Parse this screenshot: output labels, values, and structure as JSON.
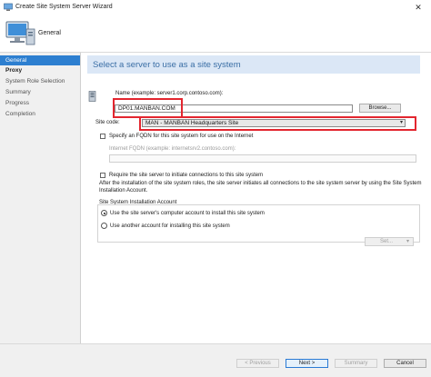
{
  "window": {
    "title": "Create Site System Server Wizard",
    "close_glyph": "✕"
  },
  "header": {
    "page_title": "General"
  },
  "nav": {
    "items": [
      {
        "label": "General"
      },
      {
        "label": "Proxy"
      },
      {
        "label": "System Role Selection"
      },
      {
        "label": "Summary"
      },
      {
        "label": "Progress"
      },
      {
        "label": "Completion"
      }
    ]
  },
  "main": {
    "heading": "Select a server to use as a site system",
    "name_label": "Name (example: server1.corp.contoso.com):",
    "name_value": "DP01.MANBAN.COM",
    "browse_label": "Browse...",
    "site_code_label": "Site code:",
    "site_code_value": "MAN - MANBAN Headquarters Site",
    "fqdn_checkbox_label": "Specify an FQDN for this site system for use on the Internet",
    "internet_fqdn_label": "Internet FQDN (example: internetsrv2.contoso.com):",
    "require_checkbox_label": "Require the site server to initiate connections to this site system",
    "info_text_line1": "After the installation of the site system roles, the site server initiates all connections to the site system server by using the Site System",
    "info_text_line2": "Installation Account.",
    "account_group_label": "Site System Installation Account",
    "radio_computer_label": "Use the site server's computer account to install this site system",
    "radio_another_label": "Use another account for installing this site system",
    "set_label": "Set..."
  },
  "footer": {
    "previous_label": "< Previous",
    "next_label": "Next >",
    "summary_label": "Summary",
    "cancel_label": "Cancel"
  },
  "colors": {
    "accent": "#2d7fd0",
    "highlight_box": "#e3262f",
    "heading": "#3a6ea5"
  }
}
